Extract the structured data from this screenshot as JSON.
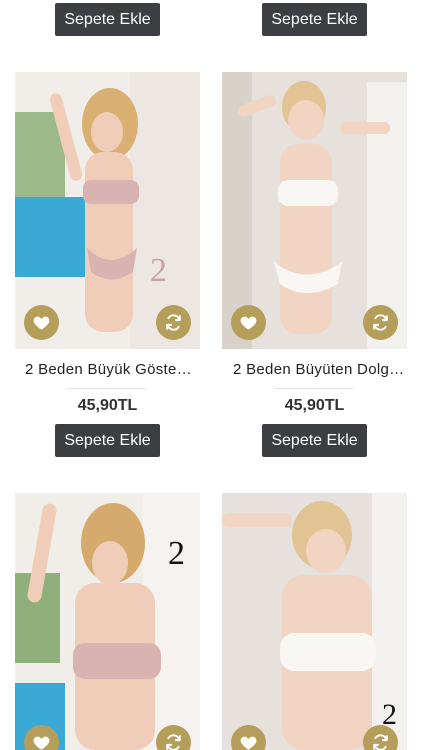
{
  "top_row": {
    "cart_buttons": [
      "Sepete Ekle",
      "Sepete Ekle"
    ]
  },
  "products": [
    {
      "name": "2 Beden Büyük Göstere…",
      "price": "45,90TL",
      "cart_label": "Sepete Ekle",
      "overlay_number": "2"
    },
    {
      "name": "2 Beden Büyüten Dolgu…",
      "price": "45,90TL",
      "cart_label": "Sepete Ekle",
      "overlay_number": ""
    },
    {
      "overlay_number": "2"
    },
    {
      "overlay_number": "2"
    }
  ],
  "icons": {
    "favorite": "heart-icon",
    "compare": "refresh-icon"
  },
  "colors": {
    "button_dark": "#3d3e41",
    "accent_gold": "#b59e5a"
  }
}
